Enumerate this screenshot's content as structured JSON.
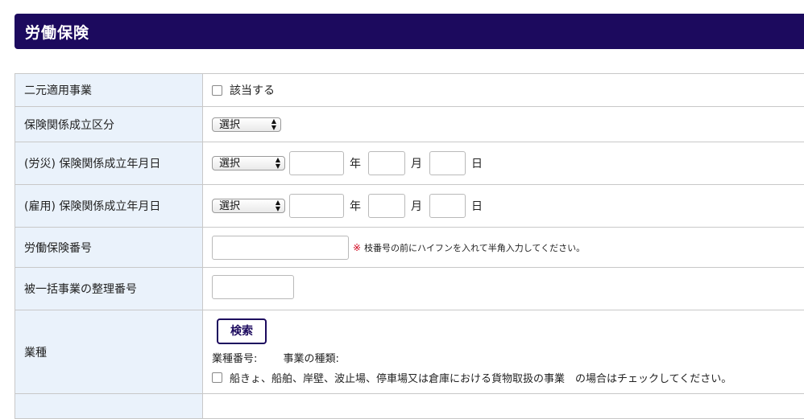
{
  "header": {
    "title": "労働保険"
  },
  "rows": {
    "dual_business": {
      "label": "二元適用事業",
      "checkbox_label": "該当する"
    },
    "insurance_class": {
      "label": "保険関係成立区分",
      "select_value": "選択"
    },
    "industrial_accident_date": {
      "label": "(労災) 保険関係成立年月日",
      "select_value": "選択",
      "year_unit": "年",
      "month_unit": "月",
      "day_unit": "日"
    },
    "employment_date": {
      "label": "(雇用) 保険関係成立年月日",
      "select_value": "選択",
      "year_unit": "年",
      "month_unit": "月",
      "day_unit": "日"
    },
    "labor_insurance_number": {
      "label": "労働保険番号",
      "note_mark": "※",
      "note": "枝番号の前にハイフンを入れて半角入力してください。"
    },
    "bulk_business_number": {
      "label": "被一括事業の整理番号"
    },
    "industry": {
      "label": "業種",
      "search_label": "検索",
      "industry_number_label": "業種番号:",
      "business_type_label": "事業の種類:",
      "cargo_note": "船きょ、船舶、岸壁、波止場、停車場又は倉庫における貨物取扱の事業　の場合はチェックしてください。"
    }
  }
}
